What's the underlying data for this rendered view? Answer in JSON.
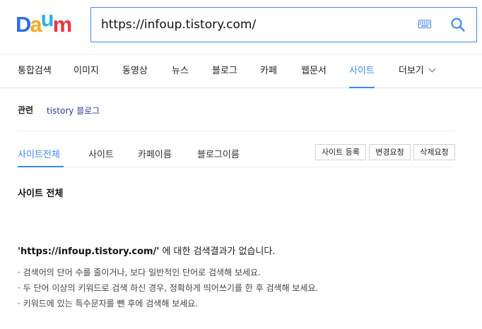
{
  "logo": {
    "text": "Daum",
    "colors": [
      "#2f6ded",
      "#f6a623",
      "#20b3e8",
      "#f0323c"
    ]
  },
  "search": {
    "value": "https://infoup.tistory.com/"
  },
  "tabs": [
    {
      "label": "통합검색"
    },
    {
      "label": "이미지"
    },
    {
      "label": "동영상"
    },
    {
      "label": "뉴스"
    },
    {
      "label": "블로그"
    },
    {
      "label": "카페"
    },
    {
      "label": "웹문서"
    },
    {
      "label": "사이트",
      "active": true
    },
    {
      "label": "더보기"
    }
  ],
  "related": {
    "label": "관련",
    "link": "tistory 블로그"
  },
  "subtabs": [
    {
      "label": "사이트전체",
      "active": true
    },
    {
      "label": "사이트"
    },
    {
      "label": "카페이름"
    },
    {
      "label": "블로그이름"
    }
  ],
  "buttons": {
    "register": "사이트 등록",
    "change": "변경요청",
    "delete": "삭제요청"
  },
  "section_title": "사이트 전체",
  "no_result": {
    "query": "'https://infoup.tistory.com/'",
    "message": "에 대한 검색결과가 없습니다."
  },
  "tips": [
    "· 검색어의 단어 수를 줄이거나, 보다 일반적인 단어로 검색해 보세요.",
    "· 두 단어 이상의 키워드로 검색 하신 경우, 정확하게 띄어쓰기를 한 후 검색해 보세요.",
    "· 키워드에 있는 특수문자를 뺀 후에 검색해 보세요."
  ],
  "accent": "#3b8af4"
}
